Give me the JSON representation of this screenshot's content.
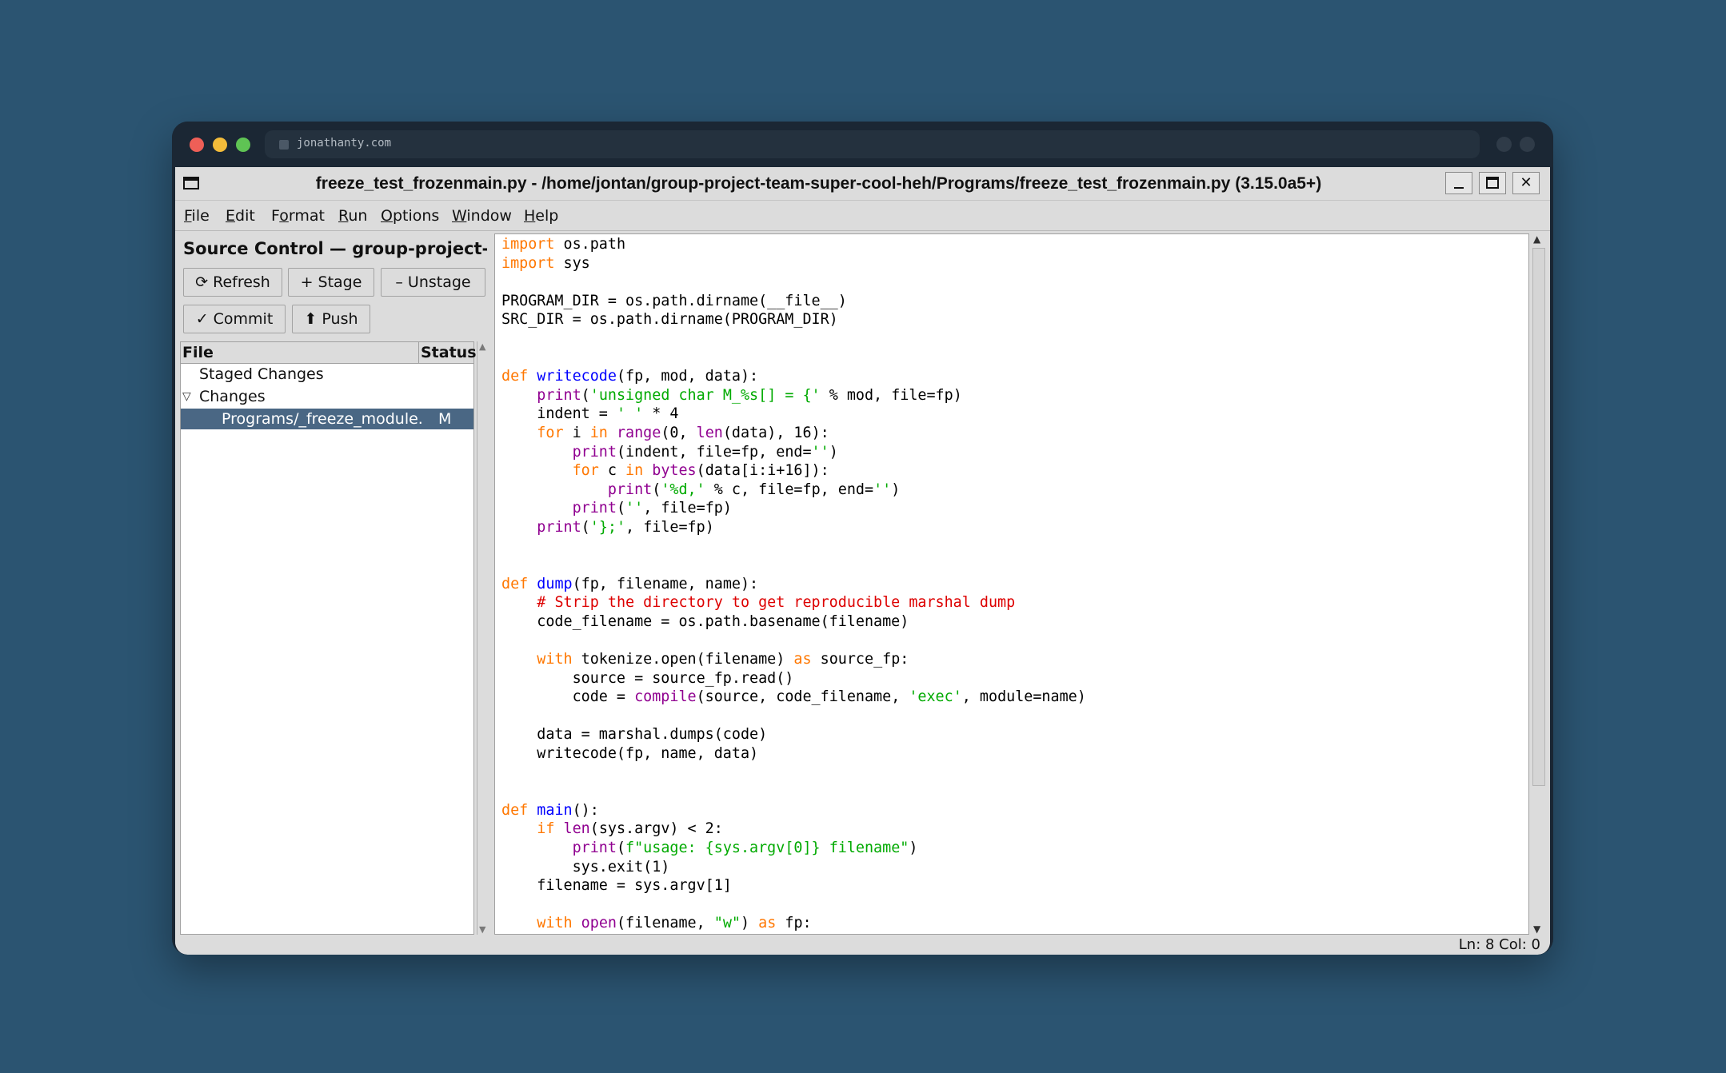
{
  "browser": {
    "url": "jonathanty.com"
  },
  "window": {
    "title": "freeze_test_frozenmain.py - /home/jontan/group-project-team-super-cool-heh/Programs/freeze_test_frozenmain.py (3.15.0a5+)",
    "minimize_icon": "minimize-icon",
    "maximize_icon": "maximize-icon",
    "close_label": "✕"
  },
  "menu": {
    "items": [
      {
        "first": "F",
        "rest": "ile"
      },
      {
        "first": "E",
        "rest": "dit"
      },
      {
        "first": "",
        "pre": "F",
        "u": "o",
        "rest": "rmat"
      },
      {
        "first": "R",
        "rest": "un"
      },
      {
        "first": "O",
        "rest": "ptions"
      },
      {
        "first": "W",
        "rest": "indow"
      },
      {
        "first": "H",
        "rest": "elp"
      }
    ]
  },
  "source_control": {
    "title": "Source Control — group-project-t",
    "buttons": {
      "refresh": "⟳ Refresh",
      "stage": "+ Stage",
      "unstage": "– Unstage",
      "commit": "✓ Commit",
      "push": "⬆ Push"
    },
    "columns": {
      "file": "File",
      "status": "Status"
    },
    "groups": {
      "staged": "Staged Changes",
      "changes": "Changes"
    },
    "changed_file": {
      "name": "Programs/_freeze_module.",
      "status": "M"
    }
  },
  "editor": {
    "lines": [
      [
        [
          "kw",
          "import"
        ],
        [
          "p",
          " os.path"
        ]
      ],
      [
        [
          "kw",
          "import"
        ],
        [
          "p",
          " sys"
        ]
      ],
      [],
      [
        [
          "p",
          "PROGRAM_DIR = os.path.dirname(__file__)"
        ]
      ],
      [
        [
          "p",
          "SRC_DIR = os.path.dirname(PROGRAM_DIR)"
        ]
      ],
      [],
      [],
      [
        [
          "kw",
          "def"
        ],
        [
          "p",
          " "
        ],
        [
          "def",
          "writecode"
        ],
        [
          "p",
          "(fp, mod, data):"
        ]
      ],
      [
        [
          "p",
          "    "
        ],
        [
          "bi",
          "print"
        ],
        [
          "p",
          "("
        ],
        [
          "str",
          "'unsigned char M_%s[] = {'"
        ],
        [
          "p",
          " % mod, file=fp)"
        ]
      ],
      [
        [
          "p",
          "    indent = "
        ],
        [
          "str",
          "' '"
        ],
        [
          "p",
          " * 4"
        ]
      ],
      [
        [
          "p",
          "    "
        ],
        [
          "kw",
          "for"
        ],
        [
          "p",
          " i "
        ],
        [
          "kw",
          "in"
        ],
        [
          "p",
          " "
        ],
        [
          "bi",
          "range"
        ],
        [
          "p",
          "(0, "
        ],
        [
          "bi",
          "len"
        ],
        [
          "p",
          "(data), 16):"
        ]
      ],
      [
        [
          "p",
          "        "
        ],
        [
          "bi",
          "print"
        ],
        [
          "p",
          "(indent, file=fp, end="
        ],
        [
          "str",
          "''"
        ],
        [
          "p",
          ")"
        ]
      ],
      [
        [
          "p",
          "        "
        ],
        [
          "kw",
          "for"
        ],
        [
          "p",
          " c "
        ],
        [
          "kw",
          "in"
        ],
        [
          "p",
          " "
        ],
        [
          "bi",
          "bytes"
        ],
        [
          "p",
          "(data[i:i+16]):"
        ]
      ],
      [
        [
          "p",
          "            "
        ],
        [
          "bi",
          "print"
        ],
        [
          "p",
          "("
        ],
        [
          "str",
          "'%d,'"
        ],
        [
          "p",
          " % c, file=fp, end="
        ],
        [
          "str",
          "''"
        ],
        [
          "p",
          ")"
        ]
      ],
      [
        [
          "p",
          "        "
        ],
        [
          "bi",
          "print"
        ],
        [
          "p",
          "("
        ],
        [
          "str",
          "''"
        ],
        [
          "p",
          ", file=fp)"
        ]
      ],
      [
        [
          "p",
          "    "
        ],
        [
          "bi",
          "print"
        ],
        [
          "p",
          "("
        ],
        [
          "str",
          "'};'"
        ],
        [
          "p",
          ", file=fp)"
        ]
      ],
      [],
      [],
      [
        [
          "kw",
          "def"
        ],
        [
          "p",
          " "
        ],
        [
          "def",
          "dump"
        ],
        [
          "p",
          "(fp, filename, name):"
        ]
      ],
      [
        [
          "p",
          "    "
        ],
        [
          "cmt",
          "# Strip the directory to get reproducible marshal dump"
        ]
      ],
      [
        [
          "p",
          "    code_filename = os.path.basename(filename)"
        ]
      ],
      [],
      [
        [
          "p",
          "    "
        ],
        [
          "kw",
          "with"
        ],
        [
          "p",
          " tokenize.open(filename) "
        ],
        [
          "kw",
          "as"
        ],
        [
          "p",
          " source_fp:"
        ]
      ],
      [
        [
          "p",
          "        source = source_fp.read()"
        ]
      ],
      [
        [
          "p",
          "        code = "
        ],
        [
          "bi",
          "compile"
        ],
        [
          "p",
          "(source, code_filename, "
        ],
        [
          "str",
          "'exec'"
        ],
        [
          "p",
          ", module=name)"
        ]
      ],
      [],
      [
        [
          "p",
          "    data = marshal.dumps(code)"
        ]
      ],
      [
        [
          "p",
          "    writecode(fp, name, data)"
        ]
      ],
      [],
      [],
      [
        [
          "kw",
          "def"
        ],
        [
          "p",
          " "
        ],
        [
          "def",
          "main"
        ],
        [
          "p",
          "():"
        ]
      ],
      [
        [
          "p",
          "    "
        ],
        [
          "kw",
          "if"
        ],
        [
          "p",
          " "
        ],
        [
          "bi",
          "len"
        ],
        [
          "p",
          "(sys.argv) < 2:"
        ]
      ],
      [
        [
          "p",
          "        "
        ],
        [
          "bi",
          "print"
        ],
        [
          "p",
          "("
        ],
        [
          "str",
          "f\"usage: {sys.argv[0]} filename\""
        ],
        [
          "p",
          ")"
        ]
      ],
      [
        [
          "p",
          "        sys.exit(1)"
        ]
      ],
      [
        [
          "p",
          "    filename = sys.argv[1]"
        ]
      ],
      [],
      [
        [
          "p",
          "    "
        ],
        [
          "kw",
          "with"
        ],
        [
          "p",
          " "
        ],
        [
          "bi",
          "open"
        ],
        [
          "p",
          "(filename, "
        ],
        [
          "str",
          "\"w\""
        ],
        [
          "p",
          ") "
        ],
        [
          "kw",
          "as"
        ],
        [
          "p",
          " fp:"
        ]
      ]
    ]
  },
  "status_bar": {
    "text": "Ln: 8  Col: 0"
  },
  "colors": {
    "keyword": "#ff7700",
    "definition": "#0000ff",
    "builtin": "#900090",
    "string": "#00aa00",
    "comment": "#dd0000",
    "selection": "#4a6784"
  }
}
